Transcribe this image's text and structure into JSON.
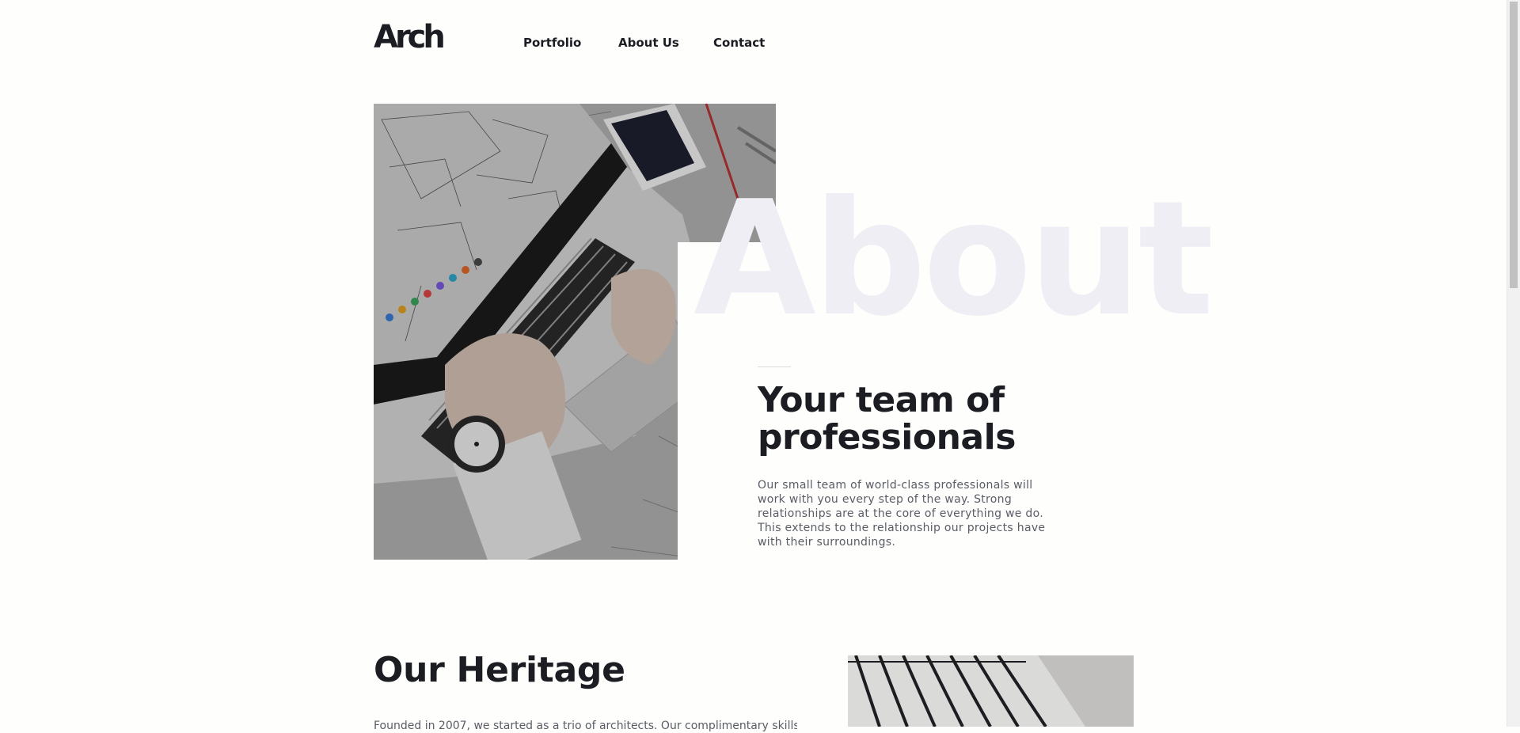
{
  "header": {
    "logo": "Arch",
    "nav": [
      {
        "label": "Portfolio"
      },
      {
        "label": "About Us"
      },
      {
        "label": "Contact"
      }
    ]
  },
  "hero": {
    "watermark": "About",
    "title": "Your team of professionals",
    "body": "Our small team of world-class professionals will work with you every step of the way. Strong relationships are at the core of everything we do. This extends to the relationship our projects have with their surroundings.",
    "photo_alt": "laptop-with-architectural-drawings-photo"
  },
  "heritage": {
    "title": "Our Heritage",
    "body": "Founded in 2007, we started as a trio of architects. Our complimentary skills"
  },
  "colors": {
    "background": "#fefefd",
    "text_dark": "#1b1d23",
    "text_body": "#5a5c66",
    "watermark": "#eeeef4"
  }
}
